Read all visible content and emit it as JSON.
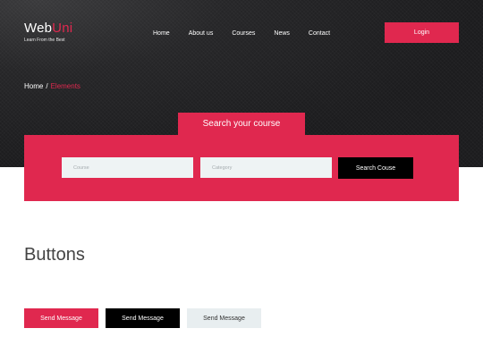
{
  "header": {
    "logo": {
      "text_main": "Web",
      "text_accent": "Uni",
      "tagline": "Learn From the Best"
    },
    "nav": [
      "Home",
      "About us",
      "Courses",
      "News",
      "Contact"
    ],
    "login_label": "Login"
  },
  "breadcrumb": {
    "home": "Home",
    "separator": "/",
    "current": "Elements"
  },
  "search": {
    "tab_label": "Search your course",
    "course_placeholder": "Course",
    "category_placeholder": "Category",
    "button_label": "Search Couse"
  },
  "buttons_section": {
    "title": "Buttons",
    "buttons": [
      "Send Message",
      "Send Message",
      "Send Message"
    ]
  },
  "colors": {
    "accent": "#e0284f",
    "dark": "#1c1c1e",
    "input_bg": "#eef3f4"
  }
}
